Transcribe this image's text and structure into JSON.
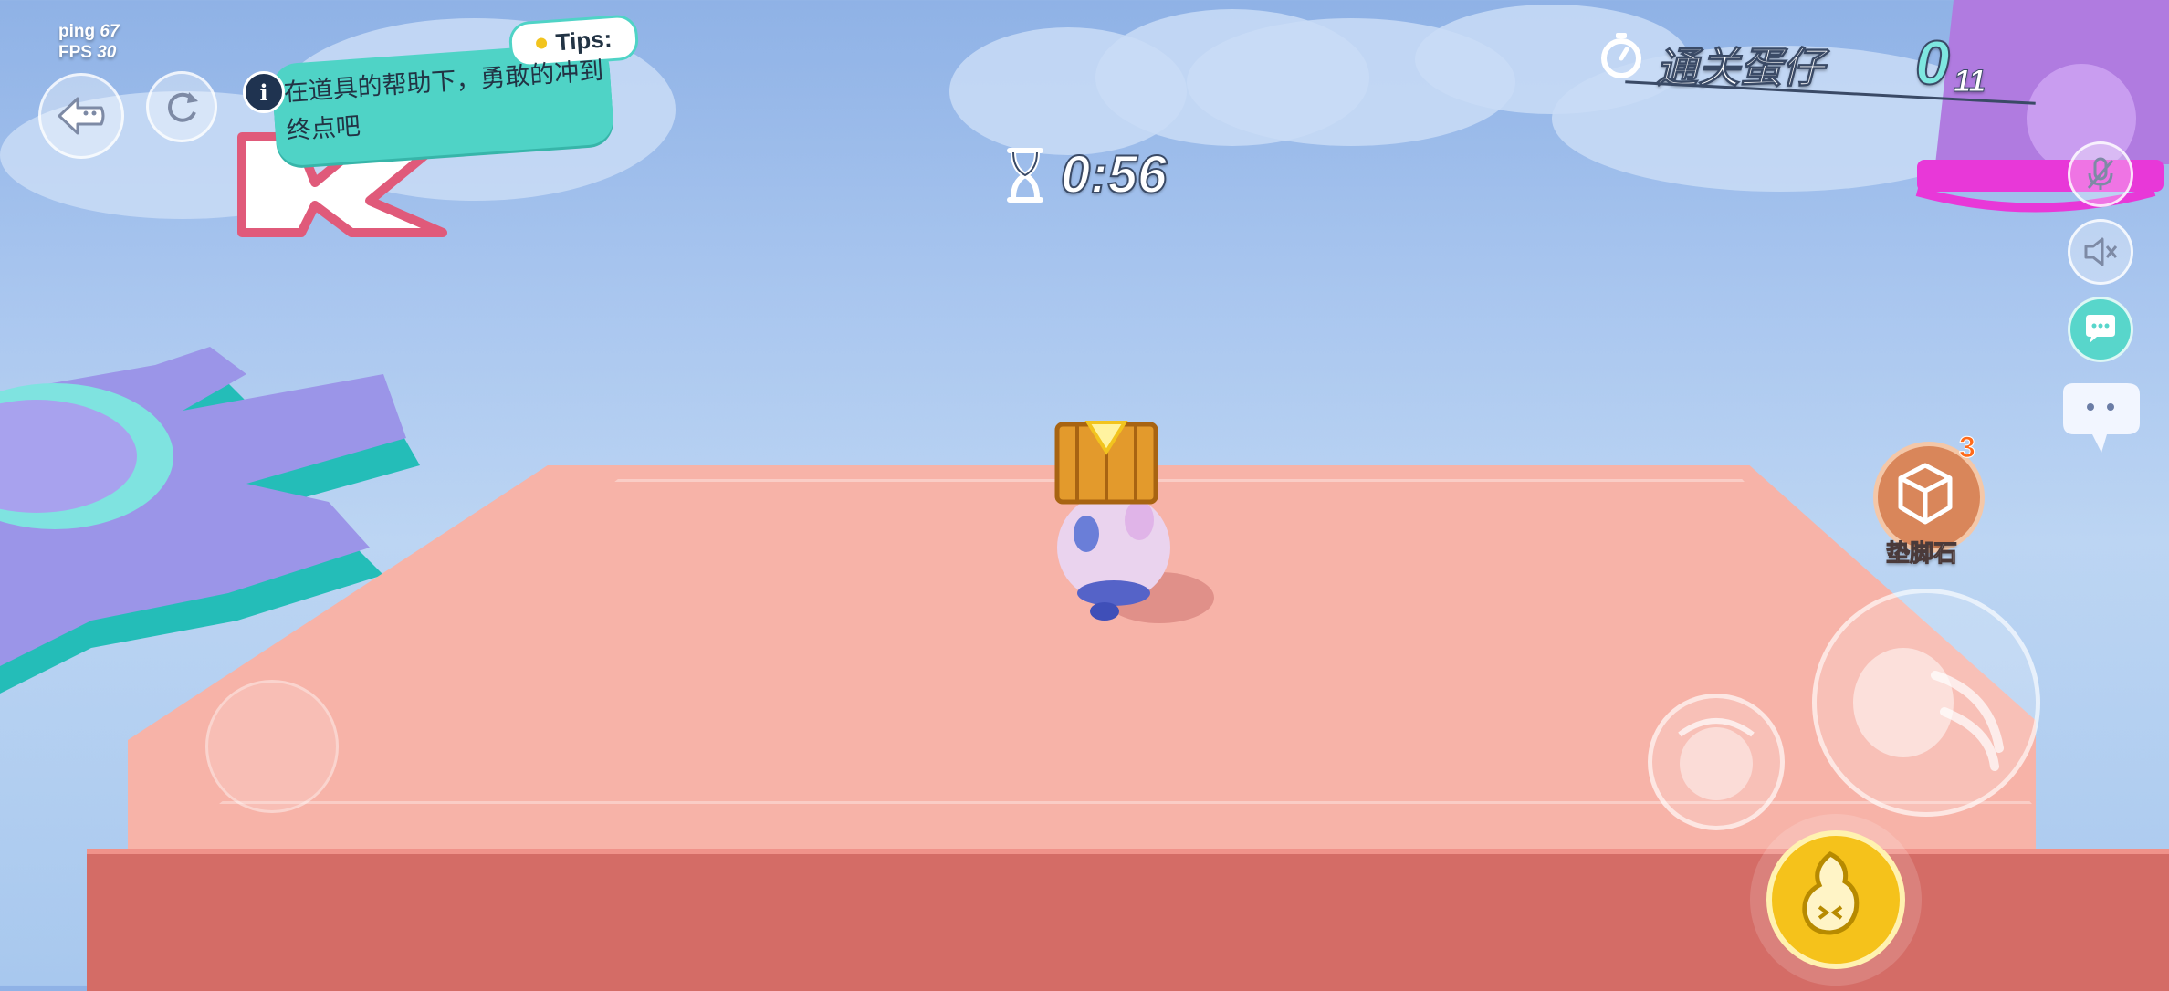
{
  "hud": {
    "ping_label": "ping",
    "ping_value": "67",
    "fps_label": "FPS",
    "fps_value": "30",
    "timer": "0:56",
    "goal_label": "通关蛋仔",
    "goal_count": "0",
    "goal_total": "11"
  },
  "tips": {
    "tag": "Tips:",
    "text": "在道具的帮助下，勇敢的冲到终点吧"
  },
  "item": {
    "name": "垫脚石",
    "count": "3"
  },
  "colors": {
    "platform_top": "#f7b3a8",
    "platform_front": "#d46c66",
    "tip_bubble": "#4fd3c6",
    "gear_purple": "#9b95e8",
    "gear_teal": "#24bdb8",
    "crate": "#e39a2c",
    "jump_button": "#f5c21b"
  }
}
